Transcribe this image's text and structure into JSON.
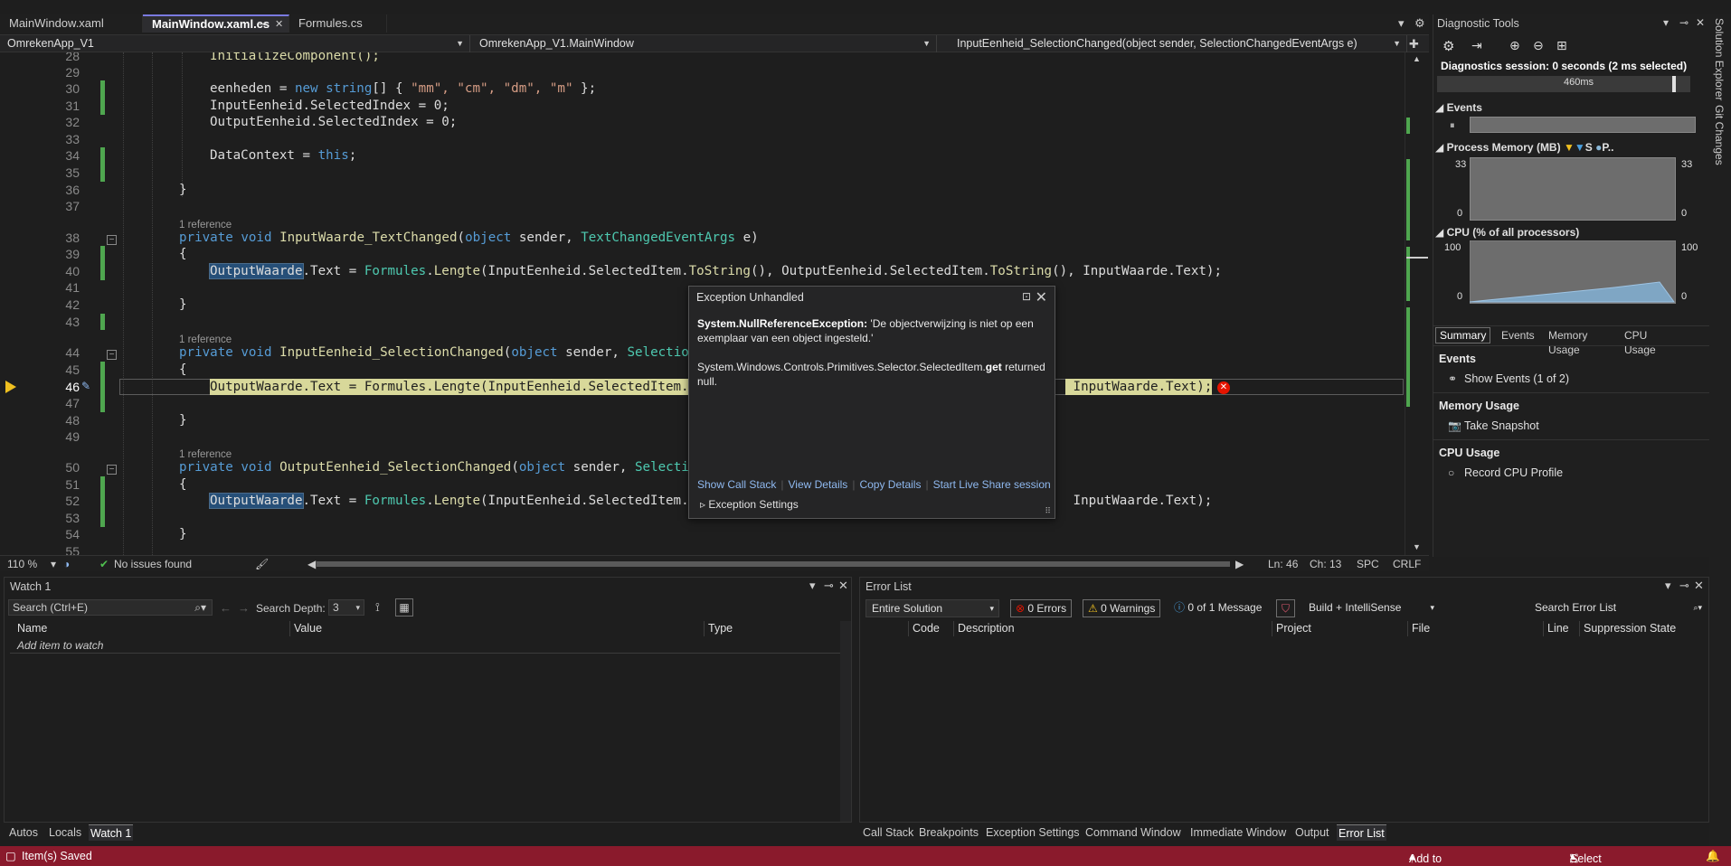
{
  "tabs": [
    {
      "label": "MainWindow.xaml",
      "active": false
    },
    {
      "label": "MainWindow.xaml.cs",
      "active": true
    },
    {
      "label": "Formules.cs",
      "active": false
    }
  ],
  "navbar": {
    "project": "OmrekenApp_V1",
    "class": "OmrekenApp_V1.MainWindow",
    "member": "InputEenheid_SelectionChanged(object sender, SelectionChangedEventArgs e)"
  },
  "editor": {
    "line_numbers": [
      "28",
      "29",
      "30",
      "31",
      "32",
      "33",
      "34",
      "35",
      "36",
      "37",
      "38",
      "39",
      "40",
      "41",
      "42",
      "43",
      "44",
      "45",
      "46",
      "47",
      "48",
      "49",
      "50",
      "51",
      "52",
      "53",
      "54",
      "55"
    ],
    "current_line": "46",
    "codelens": "1 reference",
    "code": {
      "l28": "InitializeComponent();",
      "l30a": "eenheden = ",
      "l30b": "new",
      "l30c": " ",
      "l30d": "string",
      "l30e": "[] { ",
      "l30f": "\"mm\", \"cm\", \"dm\", \"m\"",
      "l30g": " };",
      "l31": "InputEenheid.SelectedIndex = 0;",
      "l32": "OutputEenheid.SelectedIndex = 0;",
      "l34a": "DataContext = ",
      "l34b": "this",
      "l34c": ";",
      "brace_close": "}",
      "brace_open": "{",
      "l38a": "private",
      "l38b": "void",
      "l38c": "InputWaarde_TextChanged",
      "l38d": "(",
      "l38e": "object",
      "l38f": " sender, ",
      "l38g": "TextChangedEventArgs",
      "l38h": " e)",
      "l40a": "OutputWaarde",
      "l40b": ".Text = ",
      "l40c": "Formules",
      "l40d": ".",
      "l40e": "Lengte",
      "l40f": "(InputEenheid.SelectedItem.",
      "l40g": "ToString",
      "l40h": "(), OutputEenheid.SelectedItem.",
      "l40i": "ToString",
      "l40j": "(), InputWaarde.Text);",
      "l44a": "private",
      "l44b": "void",
      "l44c": "InputEenheid_SelectionChanged",
      "l44d": "(",
      "l44e": "object",
      "l44f": " sender, ",
      "l44g": "Selection",
      "l46a": "OutputWaarde.Text = Formules.Lengte(InputEenheid.SelectedItem.T",
      "l46b": " InputWaarde.Text);",
      "l50a": "private",
      "l50b": "void",
      "l50c": "OutputEenheid_SelectionChanged",
      "l50d": "(",
      "l50e": "object",
      "l50f": " sender, ",
      "l50g": "Selectio",
      "l52a": "OutputWaarde",
      "l52b": ".Text = ",
      "l52c": "Formules",
      "l52d": ".",
      "l52e": "Lengte",
      "l52f": "(InputEenheid.SelectedItem.T",
      "l52g": " InputWaarde.Text);"
    },
    "zoom": "110 %",
    "issues": "No issues found",
    "position": {
      "ln": "Ln: 46",
      "ch": "Ch: 13",
      "spc": "SPC",
      "eol": "CRLF"
    }
  },
  "exception": {
    "title": "Exception Unhandled",
    "type": "System.NullReferenceException:",
    "message": " 'De objectverwijzing is niet op een exemplaar van een object ingesteld.'",
    "detail_prefix": "System.Windows.Controls.Primitives.Selector.SelectedItem.",
    "detail_bold": "get",
    "detail_suffix": " returned null.",
    "links": [
      "Show Call Stack",
      "View Details",
      "Copy Details",
      "Start Live Share session"
    ],
    "settings": "Exception Settings"
  },
  "diagnostics": {
    "title": "Diagnostic Tools",
    "session": "Diagnostics session: 0 seconds (2 ms selected)",
    "timeline_label": "460ms",
    "events_label": "Events",
    "memory_label": "Process Memory (MB)",
    "memory_legend_s": "S",
    "memory_legend_p": "P..",
    "memory_max": "33",
    "memory_min": "0",
    "cpu_label": "CPU (% of all processors)",
    "cpu_max": "100",
    "cpu_min": "0",
    "tabs": [
      "Summary",
      "Events",
      "Memory Usage",
      "CPU Usage"
    ],
    "sections": {
      "events_head": "Events",
      "events_item": "Show Events (1 of 2)",
      "memory_head": "Memory Usage",
      "memory_item": "Take Snapshot",
      "cpu_head": "CPU Usage",
      "cpu_item": "Record CPU Profile"
    }
  },
  "right_strip": [
    "Solution Explorer",
    "Git Changes"
  ],
  "watch": {
    "title": "Watch 1",
    "search_placeholder": "Search (Ctrl+E)",
    "depth_label": "Search Depth:",
    "depth_value": "3",
    "columns": [
      "Name",
      "Value",
      "Type"
    ],
    "add_item": "Add item to watch",
    "bottom_tabs": [
      "Autos",
      "Locals",
      "Watch 1"
    ]
  },
  "error_list": {
    "title": "Error List",
    "scope": "Entire Solution",
    "errors": "0 Errors",
    "warnings": "0 Warnings",
    "messages": "0 of 1 Message",
    "build": "Build + IntelliSense",
    "search_placeholder": "Search Error List",
    "columns": [
      "Code",
      "Description",
      "Project",
      "File",
      "Line",
      "Suppression State"
    ],
    "bottom_tabs": [
      "Call Stack",
      "Breakpoints",
      "Exception Settings",
      "Command Window",
      "Immediate Window",
      "Output",
      "Error List"
    ]
  },
  "statusbar": {
    "left": "Item(s) Saved",
    "source_control": "Add to Source Control",
    "repository": "Select Repository"
  },
  "colors": {
    "statusbar_bg": "#8a1a2c",
    "keyword": "#569cd6",
    "type": "#4ec9b0",
    "method": "#dcdcaa",
    "string": "#d69d85"
  }
}
